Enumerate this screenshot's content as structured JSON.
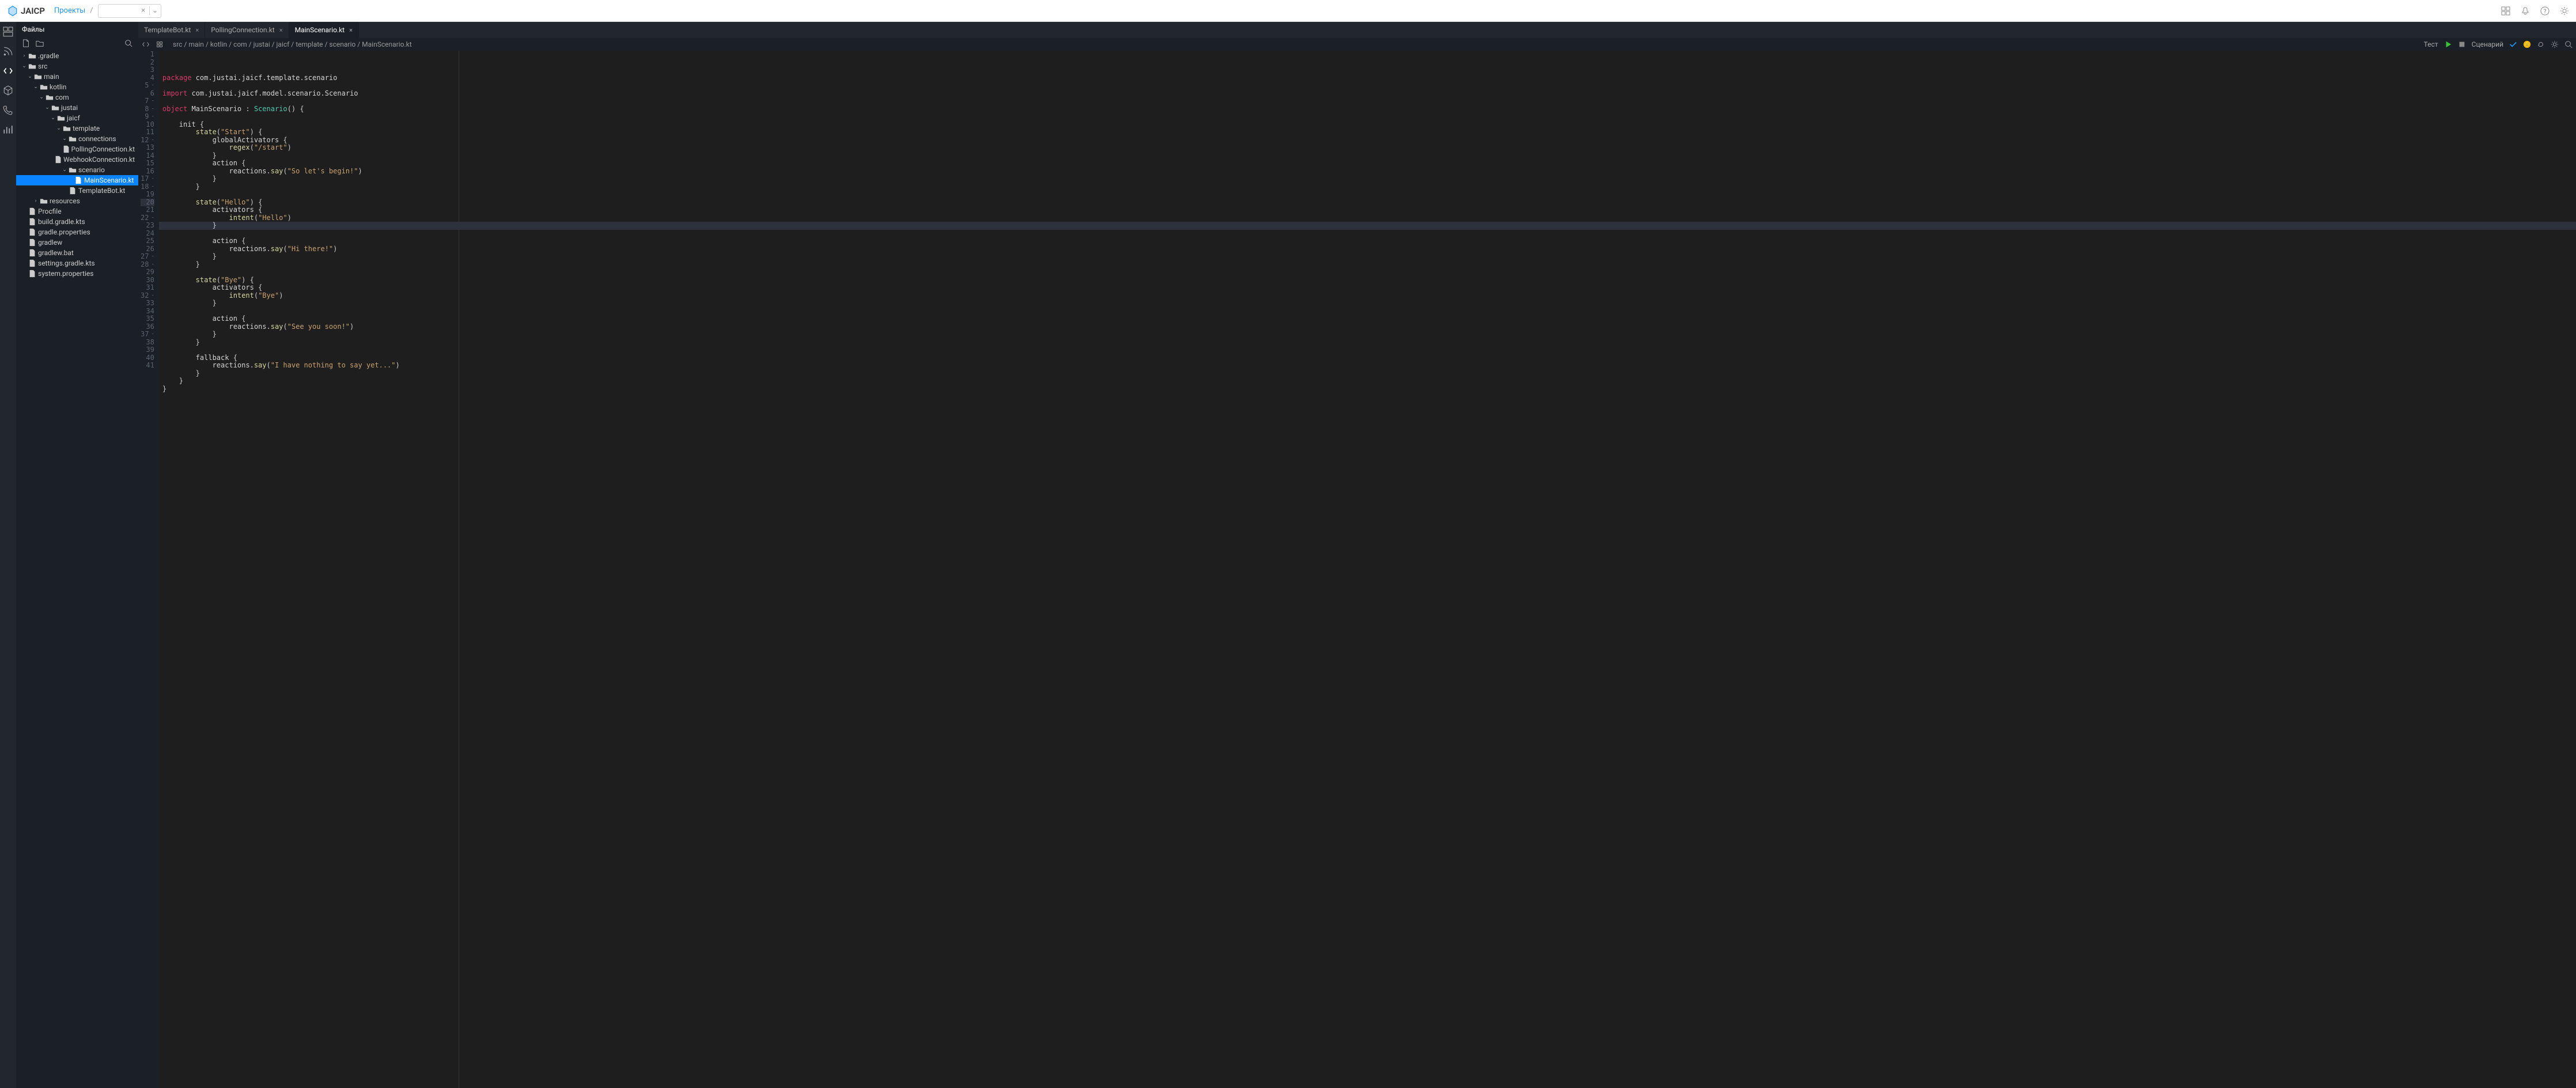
{
  "topbar": {
    "brand": "JAICP",
    "projects_link": "Проекты",
    "project_selector_value": ""
  },
  "panel": {
    "title": "Файлы"
  },
  "tree": [
    {
      "label": ".gradle",
      "depth": 0,
      "type": "folder",
      "expanded": false,
      "selected": false
    },
    {
      "label": "src",
      "depth": 0,
      "type": "folder",
      "expanded": true,
      "selected": false
    },
    {
      "label": "main",
      "depth": 1,
      "type": "folder",
      "expanded": true,
      "selected": false
    },
    {
      "label": "kotlin",
      "depth": 2,
      "type": "folder",
      "expanded": true,
      "selected": false
    },
    {
      "label": "com",
      "depth": 3,
      "type": "folder",
      "expanded": true,
      "selected": false
    },
    {
      "label": "justai",
      "depth": 4,
      "type": "folder",
      "expanded": true,
      "selected": false
    },
    {
      "label": "jaicf",
      "depth": 5,
      "type": "folder",
      "expanded": true,
      "selected": false
    },
    {
      "label": "template",
      "depth": 6,
      "type": "folder",
      "expanded": true,
      "selected": false
    },
    {
      "label": "connections",
      "depth": 7,
      "type": "folder",
      "expanded": true,
      "selected": false
    },
    {
      "label": "PollingConnection.kt",
      "depth": 8,
      "type": "file",
      "selected": false
    },
    {
      "label": "WebhookConnection.kt",
      "depth": 8,
      "type": "file",
      "selected": false
    },
    {
      "label": "scenario",
      "depth": 7,
      "type": "folder",
      "expanded": true,
      "selected": false
    },
    {
      "label": "MainScenario.kt",
      "depth": 8,
      "type": "file",
      "selected": true
    },
    {
      "label": "TemplateBot.kt",
      "depth": 7,
      "type": "file",
      "selected": false
    },
    {
      "label": "resources",
      "depth": 2,
      "type": "folder",
      "expanded": false,
      "selected": false
    },
    {
      "label": "Procfile",
      "depth": 0,
      "type": "file",
      "selected": false
    },
    {
      "label": "build.gradle.kts",
      "depth": 0,
      "type": "file",
      "selected": false
    },
    {
      "label": "gradle.properties",
      "depth": 0,
      "type": "file",
      "selected": false
    },
    {
      "label": "gradlew",
      "depth": 0,
      "type": "file",
      "selected": false
    },
    {
      "label": "gradlew.bat",
      "depth": 0,
      "type": "file",
      "selected": false
    },
    {
      "label": "settings.gradle.kts",
      "depth": 0,
      "type": "file",
      "selected": false
    },
    {
      "label": "system.properties",
      "depth": 0,
      "type": "file",
      "selected": false
    }
  ],
  "tabs": [
    {
      "label": "TemplateBot.kt",
      "active": false
    },
    {
      "label": "PollingConnection.kt",
      "active": false
    },
    {
      "label": "MainScenario.kt",
      "active": true
    }
  ],
  "toolbar": {
    "path": "src / main / kotlin / com / justai / jaicf / template / scenario / MainScenario.kt",
    "test_label": "Тест",
    "scenario_label": "Сценарий"
  },
  "code": [
    {
      "n": 1,
      "fold": "",
      "tokens": [
        {
          "t": "package ",
          "c": "kw"
        },
        {
          "t": "com",
          "c": "ident"
        },
        {
          "t": ".",
          "c": "dot"
        },
        {
          "t": "justai",
          "c": "ident"
        },
        {
          "t": ".",
          "c": "dot"
        },
        {
          "t": "jaicf",
          "c": "ident"
        },
        {
          "t": ".",
          "c": "dot"
        },
        {
          "t": "template",
          "c": "ident"
        },
        {
          "t": ".",
          "c": "dot"
        },
        {
          "t": "scenario",
          "c": "ident"
        }
      ]
    },
    {
      "n": 2,
      "fold": "",
      "tokens": []
    },
    {
      "n": 3,
      "fold": "",
      "tokens": [
        {
          "t": "import ",
          "c": "kw"
        },
        {
          "t": "com",
          "c": "ident"
        },
        {
          "t": ".",
          "c": "dot"
        },
        {
          "t": "justai",
          "c": "ident"
        },
        {
          "t": ".",
          "c": "dot"
        },
        {
          "t": "jaicf",
          "c": "ident"
        },
        {
          "t": ".",
          "c": "dot"
        },
        {
          "t": "model",
          "c": "ident"
        },
        {
          "t": ".",
          "c": "dot"
        },
        {
          "t": "scenario",
          "c": "ident"
        },
        {
          "t": ".",
          "c": "dot"
        },
        {
          "t": "Scenario",
          "c": "ident"
        }
      ]
    },
    {
      "n": 4,
      "fold": "",
      "tokens": []
    },
    {
      "n": 5,
      "fold": "-",
      "tokens": [
        {
          "t": "object ",
          "c": "kw"
        },
        {
          "t": "MainScenario",
          "c": "ident"
        },
        {
          "t": " : ",
          "c": "punc"
        },
        {
          "t": "Scenario",
          "c": "type"
        },
        {
          "t": "()",
          "c": "punc"
        },
        {
          "t": " {",
          "c": "punc"
        }
      ]
    },
    {
      "n": 6,
      "fold": "",
      "tokens": []
    },
    {
      "n": 7,
      "fold": "-",
      "tokens": [
        {
          "t": "    init ",
          "c": "ident"
        },
        {
          "t": "{",
          "c": "punc"
        }
      ]
    },
    {
      "n": 8,
      "fold": "-",
      "tokens": [
        {
          "t": "        ",
          "c": ""
        },
        {
          "t": "state",
          "c": "fn"
        },
        {
          "t": "(",
          "c": "punc"
        },
        {
          "t": "\"Start\"",
          "c": "str"
        },
        {
          "t": ")",
          "c": "punc"
        },
        {
          "t": " {",
          "c": "punc"
        }
      ]
    },
    {
      "n": 9,
      "fold": "-",
      "tokens": [
        {
          "t": "            globalActivators ",
          "c": "ident"
        },
        {
          "t": "{",
          "c": "punc"
        }
      ]
    },
    {
      "n": 10,
      "fold": "",
      "tokens": [
        {
          "t": "                ",
          "c": ""
        },
        {
          "t": "regex",
          "c": "fn"
        },
        {
          "t": "(",
          "c": "punc"
        },
        {
          "t": "\"/start\"",
          "c": "str"
        },
        {
          "t": ")",
          "c": "punc"
        }
      ]
    },
    {
      "n": 11,
      "fold": "",
      "tokens": [
        {
          "t": "            }",
          "c": "punc"
        }
      ]
    },
    {
      "n": 12,
      "fold": "-",
      "tokens": [
        {
          "t": "            action ",
          "c": "ident"
        },
        {
          "t": "{",
          "c": "punc"
        }
      ]
    },
    {
      "n": 13,
      "fold": "",
      "tokens": [
        {
          "t": "                reactions",
          "c": "ident"
        },
        {
          "t": ".",
          "c": "dot"
        },
        {
          "t": "say",
          "c": "fn"
        },
        {
          "t": "(",
          "c": "punc"
        },
        {
          "t": "\"So let's begin!\"",
          "c": "str"
        },
        {
          "t": ")",
          "c": "punc"
        }
      ]
    },
    {
      "n": 14,
      "fold": "",
      "tokens": [
        {
          "t": "            }",
          "c": "punc"
        }
      ]
    },
    {
      "n": 15,
      "fold": "",
      "tokens": [
        {
          "t": "        }",
          "c": "punc"
        }
      ]
    },
    {
      "n": 16,
      "fold": "",
      "tokens": []
    },
    {
      "n": 17,
      "fold": "-",
      "tokens": [
        {
          "t": "        ",
          "c": ""
        },
        {
          "t": "state",
          "c": "fn"
        },
        {
          "t": "(",
          "c": "punc"
        },
        {
          "t": "\"Hello\"",
          "c": "str"
        },
        {
          "t": ")",
          "c": "punc"
        },
        {
          "t": " {",
          "c": "punc"
        }
      ]
    },
    {
      "n": 18,
      "fold": "-",
      "tokens": [
        {
          "t": "            activators ",
          "c": "ident"
        },
        {
          "t": "{",
          "c": "punc"
        }
      ]
    },
    {
      "n": 19,
      "fold": "",
      "tokens": [
        {
          "t": "                ",
          "c": ""
        },
        {
          "t": "intent",
          "c": "fn"
        },
        {
          "t": "(",
          "c": "punc"
        },
        {
          "t": "\"Hello\"",
          "c": "str"
        },
        {
          "t": ")",
          "c": "punc"
        }
      ]
    },
    {
      "n": 20,
      "fold": "",
      "hl": true,
      "tokens": [
        {
          "t": "            }",
          "c": "punc"
        }
      ]
    },
    {
      "n": 21,
      "fold": "",
      "tokens": []
    },
    {
      "n": 22,
      "fold": "-",
      "tokens": [
        {
          "t": "            action ",
          "c": "ident"
        },
        {
          "t": "{",
          "c": "punc"
        }
      ]
    },
    {
      "n": 23,
      "fold": "",
      "tokens": [
        {
          "t": "                reactions",
          "c": "ident"
        },
        {
          "t": ".",
          "c": "dot"
        },
        {
          "t": "say",
          "c": "fn"
        },
        {
          "t": "(",
          "c": "punc"
        },
        {
          "t": "\"Hi there!\"",
          "c": "str"
        },
        {
          "t": ")",
          "c": "punc"
        }
      ]
    },
    {
      "n": 24,
      "fold": "",
      "tokens": [
        {
          "t": "            }",
          "c": "punc"
        }
      ]
    },
    {
      "n": 25,
      "fold": "",
      "tokens": [
        {
          "t": "        }",
          "c": "punc"
        }
      ]
    },
    {
      "n": 26,
      "fold": "",
      "tokens": []
    },
    {
      "n": 27,
      "fold": "-",
      "tokens": [
        {
          "t": "        ",
          "c": ""
        },
        {
          "t": "state",
          "c": "fn"
        },
        {
          "t": "(",
          "c": "punc"
        },
        {
          "t": "\"Bye\"",
          "c": "str"
        },
        {
          "t": ")",
          "c": "punc"
        },
        {
          "t": " {",
          "c": "punc"
        }
      ]
    },
    {
      "n": 28,
      "fold": "-",
      "tokens": [
        {
          "t": "            activators ",
          "c": "ident"
        },
        {
          "t": "{",
          "c": "punc"
        }
      ]
    },
    {
      "n": 29,
      "fold": "",
      "tokens": [
        {
          "t": "                ",
          "c": ""
        },
        {
          "t": "intent",
          "c": "fn"
        },
        {
          "t": "(",
          "c": "punc"
        },
        {
          "t": "\"Bye\"",
          "c": "str"
        },
        {
          "t": ")",
          "c": "punc"
        }
      ]
    },
    {
      "n": 30,
      "fold": "",
      "tokens": [
        {
          "t": "            }",
          "c": "punc"
        }
      ]
    },
    {
      "n": 31,
      "fold": "",
      "tokens": []
    },
    {
      "n": 32,
      "fold": "-",
      "tokens": [
        {
          "t": "            action ",
          "c": "ident"
        },
        {
          "t": "{",
          "c": "punc"
        }
      ]
    },
    {
      "n": 33,
      "fold": "",
      "tokens": [
        {
          "t": "                reactions",
          "c": "ident"
        },
        {
          "t": ".",
          "c": "dot"
        },
        {
          "t": "say",
          "c": "fn"
        },
        {
          "t": "(",
          "c": "punc"
        },
        {
          "t": "\"See you soon!\"",
          "c": "str"
        },
        {
          "t": ")",
          "c": "punc"
        }
      ]
    },
    {
      "n": 34,
      "fold": "",
      "tokens": [
        {
          "t": "            }",
          "c": "punc"
        }
      ]
    },
    {
      "n": 35,
      "fold": "",
      "tokens": [
        {
          "t": "        }",
          "c": "punc"
        }
      ]
    },
    {
      "n": 36,
      "fold": "",
      "tokens": []
    },
    {
      "n": 37,
      "fold": "-",
      "tokens": [
        {
          "t": "        fallback ",
          "c": "ident"
        },
        {
          "t": "{",
          "c": "punc"
        }
      ]
    },
    {
      "n": 38,
      "fold": "",
      "tokens": [
        {
          "t": "            reactions",
          "c": "ident"
        },
        {
          "t": ".",
          "c": "dot"
        },
        {
          "t": "say",
          "c": "fn"
        },
        {
          "t": "(",
          "c": "punc"
        },
        {
          "t": "\"I have nothing to say yet...\"",
          "c": "str"
        },
        {
          "t": ")",
          "c": "punc"
        }
      ]
    },
    {
      "n": 39,
      "fold": "",
      "tokens": [
        {
          "t": "        }",
          "c": "punc"
        }
      ]
    },
    {
      "n": 40,
      "fold": "",
      "tokens": [
        {
          "t": "    }",
          "c": "punc"
        }
      ]
    },
    {
      "n": 41,
      "fold": "",
      "tokens": [
        {
          "t": "}",
          "c": "punc"
        }
      ]
    }
  ]
}
